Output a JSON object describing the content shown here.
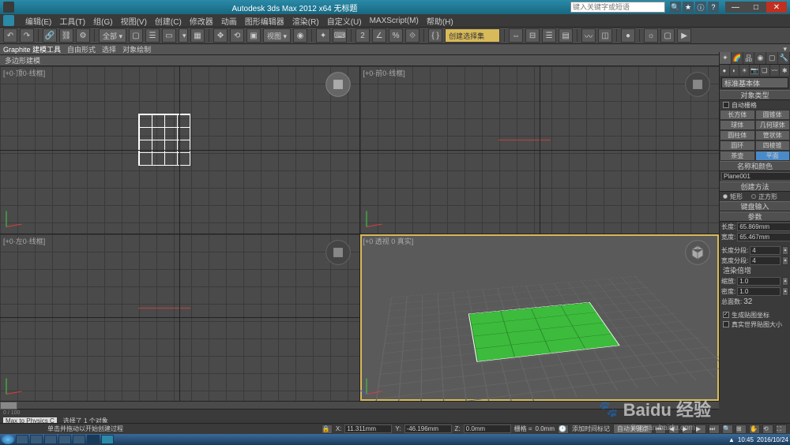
{
  "titlebar": {
    "title": "Autodesk 3ds Max 2012 x64  无标题",
    "search_placeholder": "键入关键字或短语"
  },
  "menu": [
    "编辑(E)",
    "工具(T)",
    "组(G)",
    "视图(V)",
    "创建(C)",
    "修改器",
    "动画",
    "图形编辑器",
    "渲染(R)",
    "自定义(U)",
    "MAXScript(M)",
    "帮助(H)"
  ],
  "toolbar": {
    "dropdown1": "全部 ▾",
    "dropdown2": "▾",
    "dropdown3": "视图 ▾",
    "sel_set": "创建选择集"
  },
  "ribbon": {
    "tabs": [
      "Graphite 建模工具",
      "自由形式",
      "选择",
      "对象绘制"
    ]
  },
  "subbar": "多边形建模",
  "viewports": {
    "top": "[+0·顶0·线框]",
    "front": "[+0·前0·线框]",
    "left": "[+0·左0·线框]",
    "persp": "[+0 透视 0 真实]"
  },
  "panel": {
    "category": "标准基本体",
    "section_obj_type": "对象类型",
    "auto_grid": "自动栅格",
    "primitives": [
      [
        "长方体",
        "圆锥体"
      ],
      [
        "球体",
        "几何球体"
      ],
      [
        "圆柱体",
        "管状体"
      ],
      [
        "圆环",
        "四棱锥"
      ],
      [
        "茶壶",
        "平面"
      ]
    ],
    "section_name_color": "名称和颜色",
    "object_name": "Plane001",
    "section_create_method": "创建方法",
    "radio_rect": "矩形",
    "radio_square": "正方形",
    "section_kb_entry": "键盘输入",
    "section_params": "参数",
    "length_label": "长度:",
    "length_val": "65.869mm",
    "width_label": "宽度:",
    "width_val": "65.467mm",
    "lseg_label": "长度分段:",
    "lseg_val": "4",
    "wseg_label": "宽度分段:",
    "wseg_val": "4",
    "section_render_mult": "渲染倍增",
    "scale_label": "缩放:",
    "scale_val": "1.0",
    "density_label": "密度:",
    "density_val": "1.0",
    "total_faces_label": "总面数:",
    "total_faces_val": "32",
    "gen_coords": "生成贴图坐标",
    "real_world": "真实世界贴图大小"
  },
  "timeline": {
    "range": "0 / 100"
  },
  "status": {
    "selected": "选择了 1 个对象",
    "prompt": "单击并拖动以开始创建过程",
    "max_physics": "Max to Physics C"
  },
  "coords": {
    "x_label": "X:",
    "x_val": "11.311mm",
    "y_label": "Y:",
    "y_val": "-46.196mm",
    "z_label": "Z:",
    "z_val": "0.0mm",
    "grid_label": "栅格 =",
    "grid_val": "0.0mm",
    "add_time_tag": "添加时间标记",
    "auto_key": "自动关键点"
  },
  "taskbar_time": "10:45",
  "taskbar_date": "2016/10/24",
  "watermark": "Baidu 经验",
  "watermark_sub": "jingyan.baidu.com"
}
